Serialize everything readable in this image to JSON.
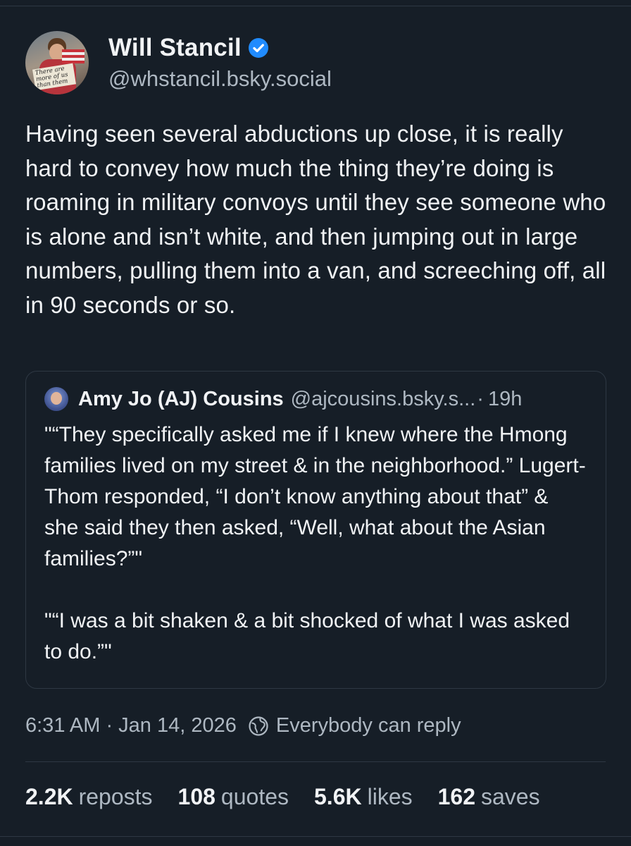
{
  "author": {
    "display_name": "Will Stancil",
    "handle": "@whstancil.bsky.social",
    "avatar_sign_text": "There are more of us than them"
  },
  "post": {
    "text": "Having seen several abductions up close, it is really hard to convey how much the thing they’re doing is roaming in military convoys until they see someone who is alone and isn’t white, and then jumping out in large numbers, pulling them into a van, and screeching off, all in 90 seconds or so."
  },
  "quote": {
    "name": "Amy Jo (AJ) Cousins",
    "handle": "@ajcousins.bsky.s...",
    "dot": "·",
    "time": "19h",
    "text": "\"“They specifically asked me if I knew where the Hmong families lived on my street & in the neighborhood.” Lugert-Thom responded, “I don’t know anything about that” & she said they then asked, “Well, what about the Asian families?”\"\n\n\"“I was a bit shaken & a bit shocked of what I was asked to do.”\""
  },
  "meta": {
    "timestamp": "6:31 AM · Jan 14, 2026",
    "reply_setting": "Everybody can reply"
  },
  "stats": {
    "reposts_count": "2.2K",
    "reposts_label": "reposts",
    "quotes_count": "108",
    "quotes_label": "quotes",
    "likes_count": "5.6K",
    "likes_label": "likes",
    "saves_count": "162",
    "saves_label": "saves"
  },
  "colors": {
    "background": "#161e27",
    "text_primary": "#f1f3f5",
    "text_secondary": "#aeb8c2",
    "verified_badge": "#208bfe",
    "border": "#2e3843"
  },
  "icons": {
    "verified": "verified-check-icon",
    "reply_setting": "globe-icon"
  }
}
